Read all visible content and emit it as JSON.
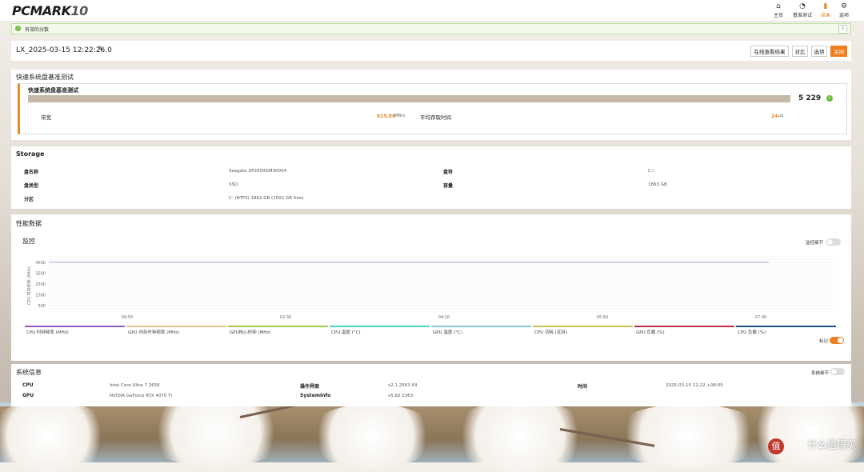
{
  "app": {
    "logo": "PCMARK",
    "logo_num": "10"
  },
  "nav": [
    {
      "label": "主页",
      "icon": "⌂"
    },
    {
      "label": "基准测试",
      "icon": "◔"
    },
    {
      "label": "结果",
      "icon": "▮"
    },
    {
      "label": "选项",
      "icon": "⚙"
    }
  ],
  "notice": {
    "text": "有效的分数",
    "help": "?"
  },
  "run": {
    "name": "LX_2025-03-15 12:22:26.0"
  },
  "buttons": {
    "online": "在线查看结果",
    "compare": "对比",
    "options": "选项",
    "close": "关闭"
  },
  "benchmark": {
    "section_title": "快速系统盘基准测试",
    "sub_title": "快速系统盘基准测试",
    "score": "5 229",
    "bandwidth_label": "带宽",
    "bandwidth_value": "625.86",
    "bandwidth_unit": "MB/s",
    "access_label": "平均存取时间",
    "access_value": "24",
    "access_unit": "µs"
  },
  "storage": {
    "title": "Storage",
    "disk_name_label": "盘名称",
    "disk_name": "Seagate ZP2000GM30004",
    "drive_label": "盘符",
    "drive": "C:\\",
    "disk_type_label": "盘类型",
    "disk_type": "SSD",
    "capacity_label": "容量",
    "capacity": "1863 GB",
    "partition_label": "分区",
    "partition": "C: (NTFS) 1862 GB (1502 GB free)"
  },
  "perf": {
    "title": "性能数据",
    "monitor_title": "监控",
    "monitor_detail": "监控细节",
    "marks": "标记",
    "yaxis_label": "CPU 时钟频率 (MHz)",
    "legend": [
      {
        "label": "CPU 时钟频率 (MHz)",
        "color": "#8e5bc7"
      },
      {
        "label": "GPU 内存时钟频率 (MHz)",
        "color": "#e2c98a"
      },
      {
        "label": "GPU核心时钟 (MHz)",
        "color": "#a6c94a"
      },
      {
        "label": "CPU 温度 (°C)",
        "color": "#4fd1c5"
      },
      {
        "label": "GPU 温度 (°C)",
        "color": "#8fc7e8"
      },
      {
        "label": "CPU 功耗 (瓦特)",
        "color": "#c9c04a"
      },
      {
        "label": "GPU 负载 (%)",
        "color": "#c0304a"
      },
      {
        "label": "CPU 负载 (%)",
        "color": "#1f4f8a"
      }
    ]
  },
  "sysinfo": {
    "title": "系统信息",
    "detail": "系统细节",
    "cpu_label": "CPU",
    "cpu": "Intel Core Ultra 7 265K",
    "gpu_label": "GPU",
    "gpu": "NVIDIA GeForce RTX 4070 Ti",
    "os_label": "操作界面",
    "os": "v2.1.2563 64",
    "sysinfo_label": "SystemInfo",
    "sysinfo_ver": "v5.82.1363",
    "time_label": "时间",
    "time": "2025-03-15 12:22 +08:00"
  },
  "chart_data": {
    "type": "line",
    "x_ticks": [
      "00:50",
      "02:30",
      "04:10",
      "05:50",
      "07:30"
    ],
    "y_ticks": [
      500,
      1500,
      2500,
      3500,
      4500
    ],
    "ylim": [
      0,
      5000
    ],
    "ylabel": "CPU 时钟频率 (MHz)",
    "series": [
      {
        "name": "CPU 时钟频率 (MHz)",
        "values": [
          4500,
          4500,
          4500,
          4500,
          4500,
          4500,
          4500,
          4500,
          4500,
          4500
        ],
        "color": "#a89bd0"
      }
    ],
    "grid": true
  },
  "watermark": {
    "text": "什么值得买",
    "icon": "值"
  }
}
